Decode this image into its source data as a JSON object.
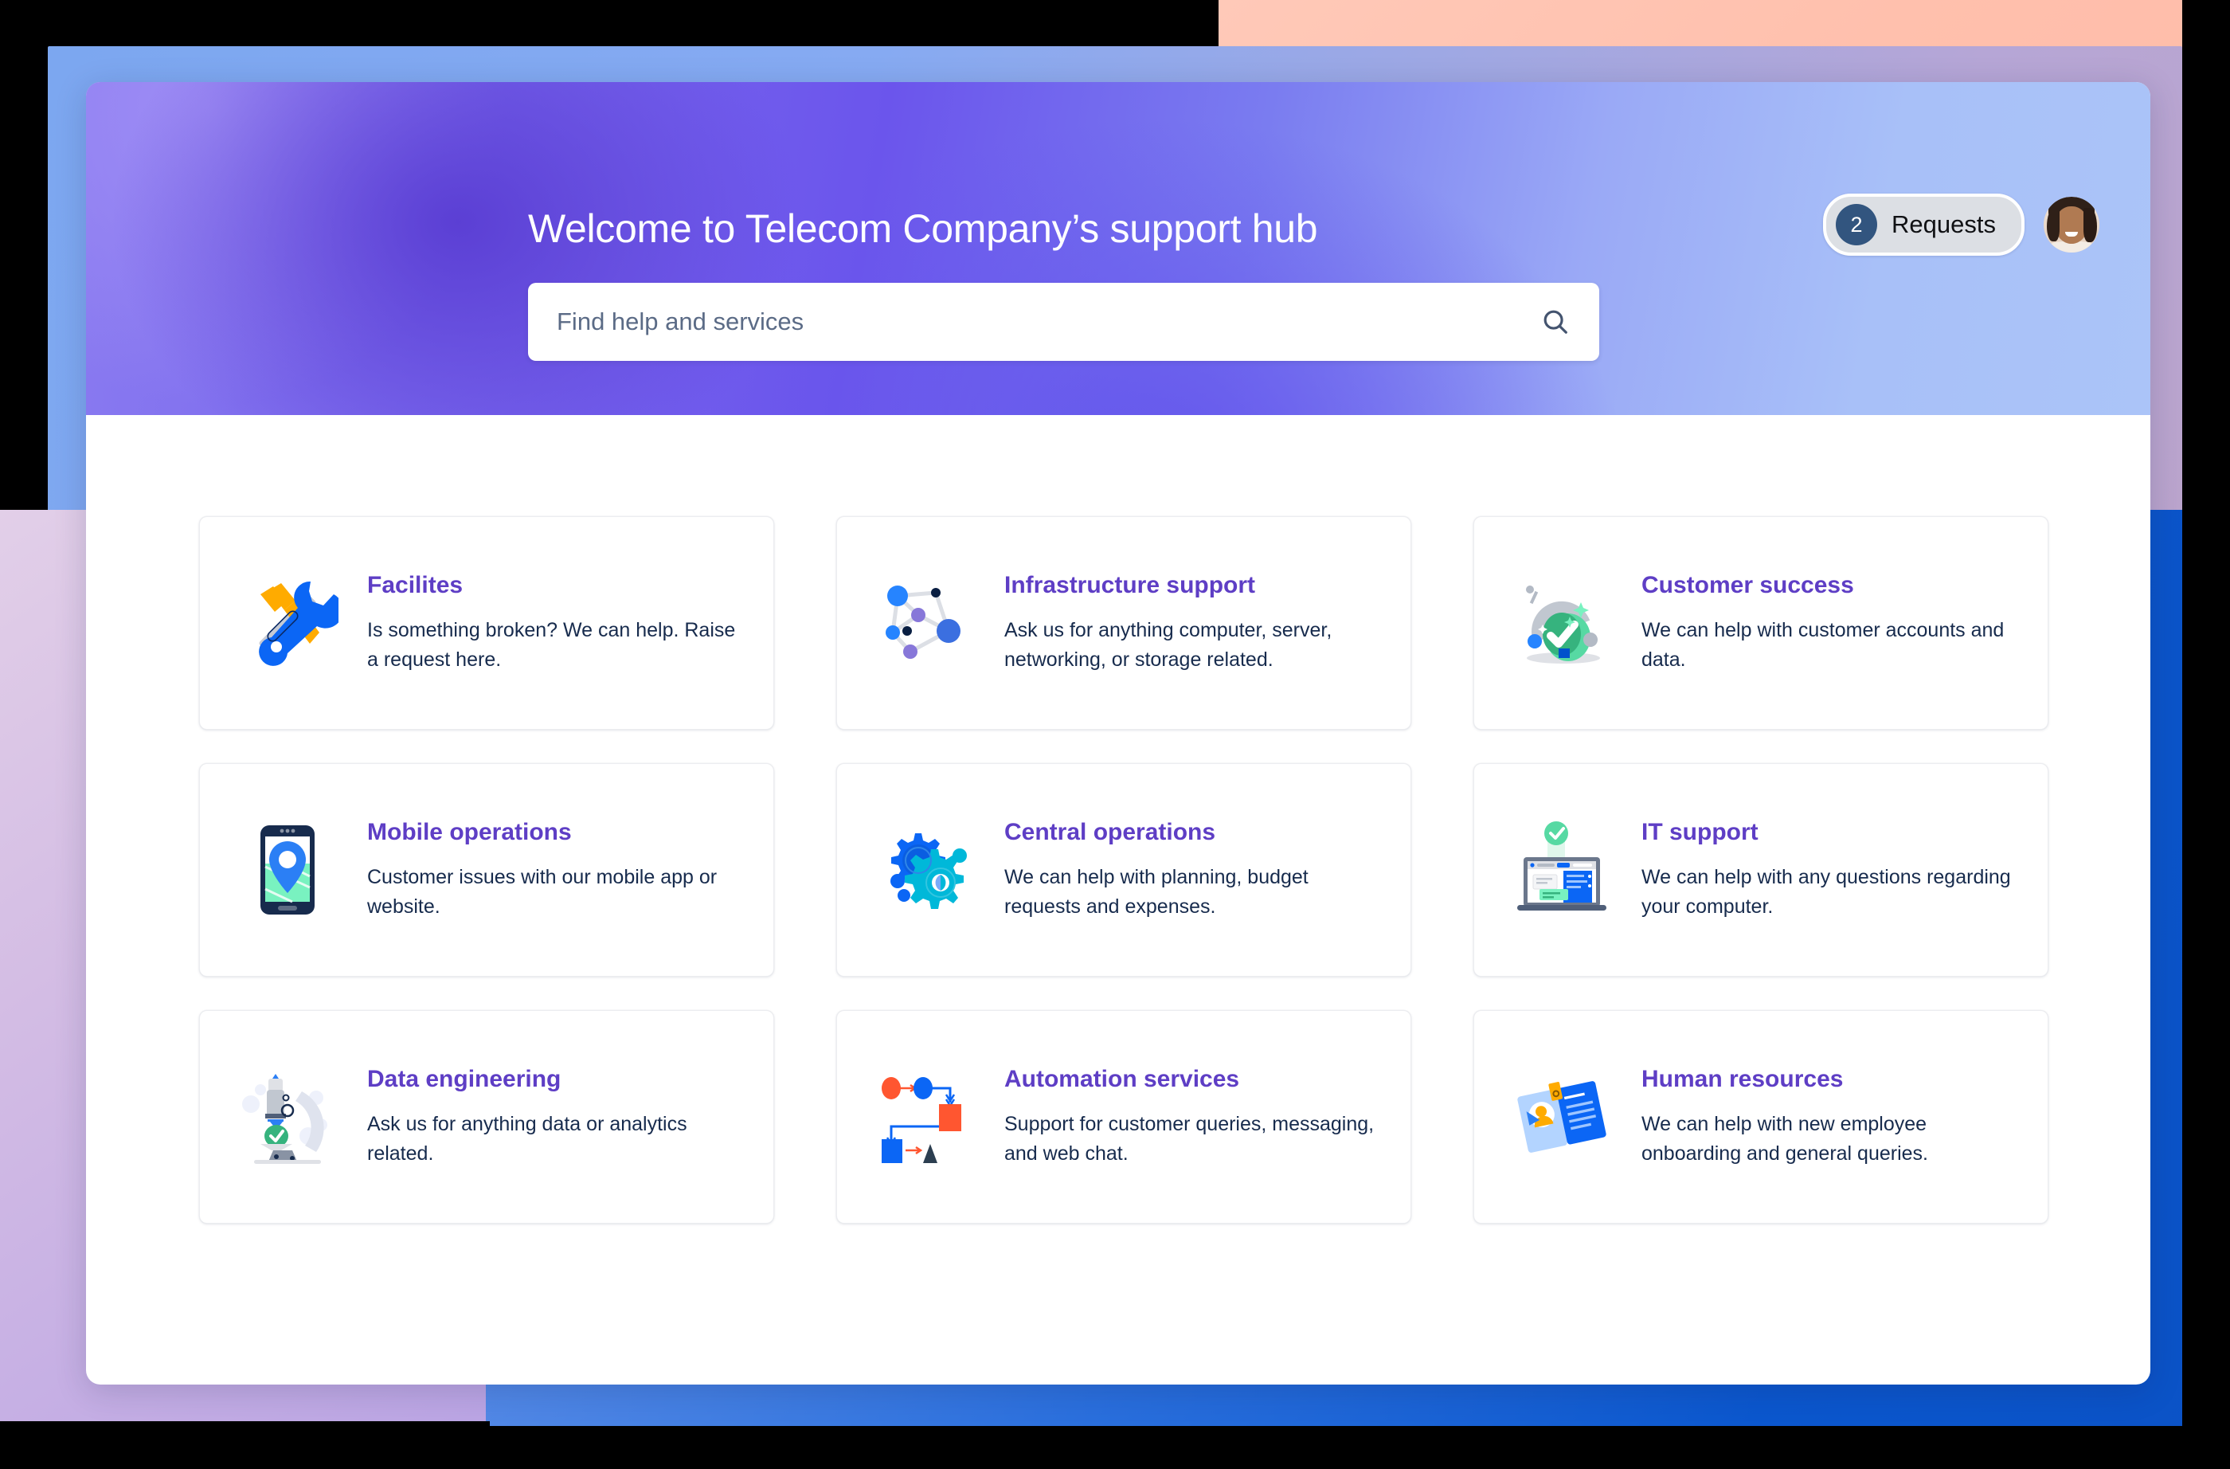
{
  "background": {
    "peach": "#ffc0ad",
    "periwinkle": "#86aaf2",
    "blue": "#0b57ce",
    "lilac": "#c9b4e6",
    "black": "#000000"
  },
  "hero": {
    "title": "Welcome to Telecom Company’s support hub",
    "accent_purple": "#6b55ec",
    "search": {
      "value": "",
      "placeholder": "Find help and services",
      "icon": "search-icon"
    },
    "requests": {
      "count": "2",
      "label": "Requests",
      "badge_color": "#32557f",
      "pill_color": "#dcdfe4"
    },
    "avatar": {
      "alt": "User profile photo"
    }
  },
  "cards": [
    {
      "title": "Facilites",
      "desc": "Is something broken? We can help. Raise a request here.",
      "icon": "tools-icon"
    },
    {
      "title": "Infrastructure support",
      "desc": "Ask us for anything computer, server, networking, or storage related.",
      "icon": "network-nodes-icon"
    },
    {
      "title": "Customer success",
      "desc": "We can help with customer accounts and data.",
      "icon": "cloche-checkmark-icon"
    },
    {
      "title": "Mobile operations",
      "desc": "Customer issues with our mobile app or website.",
      "icon": "phone-map-pin-icon"
    },
    {
      "title": "Central operations",
      "desc": "We can help with planning, budget requests and expenses.",
      "icon": "gears-icon"
    },
    {
      "title": "IT support",
      "desc": "We can help with any questions regarding your computer.",
      "icon": "laptop-check-icon"
    },
    {
      "title": "Data engineering",
      "desc": "Ask us for anything data or analytics related.",
      "icon": "microscope-icon"
    },
    {
      "title": "Automation services",
      "desc": "Support for customer queries, messaging, and web chat.",
      "icon": "flowchart-icon"
    },
    {
      "title": "Human resources",
      "desc": "We can help with new employee onboarding and general queries.",
      "icon": "id-card-icon"
    }
  ],
  "colors": {
    "card_title": "#5e3ec5",
    "card_desc": "#172b4d",
    "card_bg": "#ffffff"
  }
}
